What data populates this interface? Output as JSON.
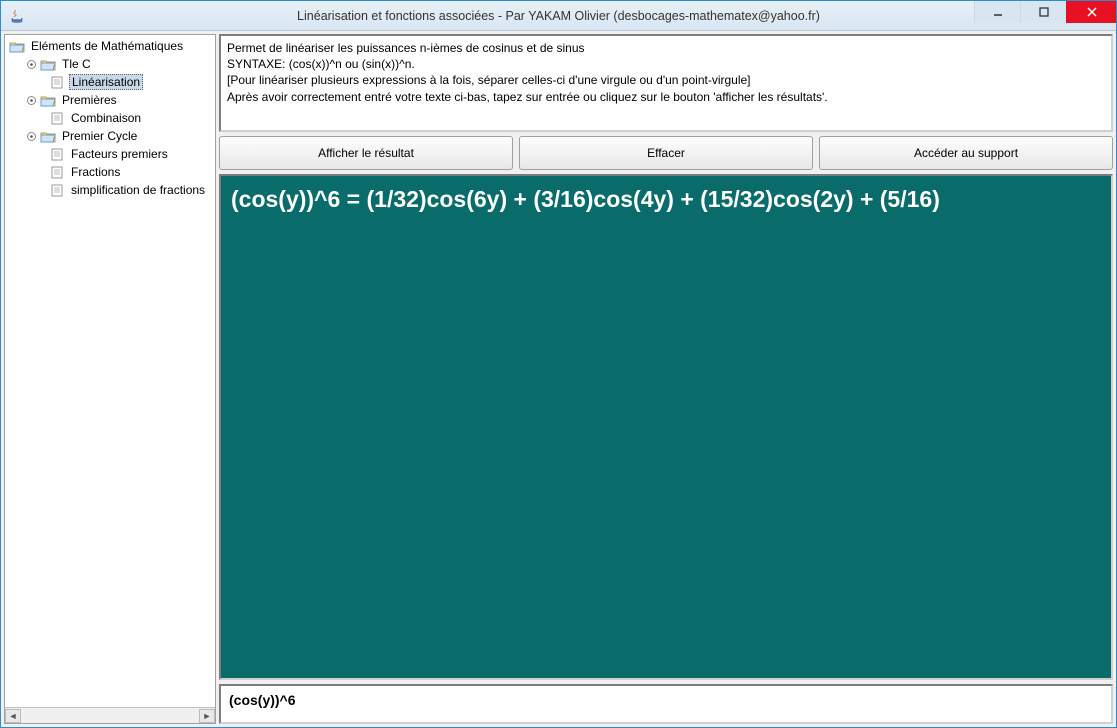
{
  "window": {
    "title": "Linéarisation et fonctions associées - Par YAKAM Olivier (desbocages-mathematex@yahoo.fr)"
  },
  "tree": {
    "root": "Eléments de Mathématiques",
    "n1": "Tle C",
    "n1_1": "Linéarisation",
    "n2": "Premières",
    "n2_1": "Combinaison",
    "n3": "Premier Cycle",
    "n3_1": "Facteurs premiers",
    "n3_2": "Fractions",
    "n3_3": "simplification de fractions"
  },
  "desc": {
    "l1": "Permet de linéariser les puissances n-ièmes de cosinus et de sinus",
    "l2": "SYNTAXE: (cos(x))^n ou (sin(x))^n.",
    "l3": "[Pour linéariser plusieurs expressions à la fois, séparer celles-ci d'une virgule ou d'un point-virgule]",
    "l4": "Après avoir correctement entré votre texte ci-bas, tapez sur entrée ou cliquez sur le bouton 'afficher les résultats'."
  },
  "buttons": {
    "show": "Afficher le résultat",
    "clear": "Effacer",
    "support": "Accéder au support"
  },
  "result": "(cos(y))^6 = (1/32)cos(6y) + (3/16)cos(4y) + (15/32)cos(2y) + (5/16)",
  "input": "(cos(y))^6"
}
